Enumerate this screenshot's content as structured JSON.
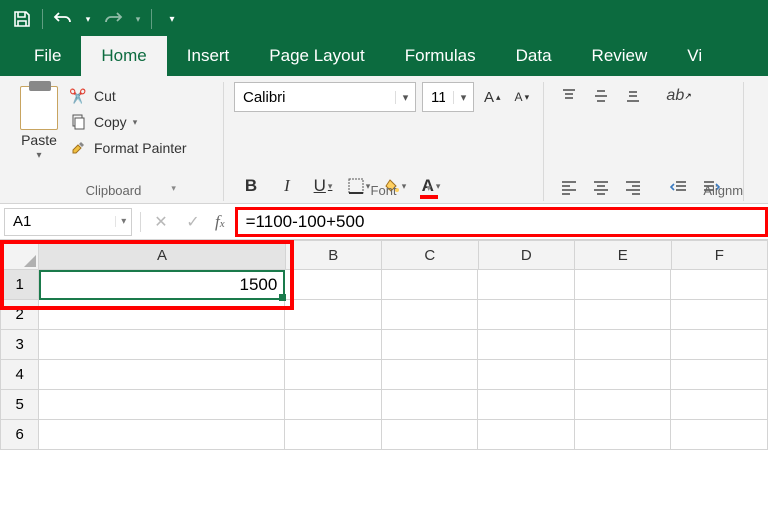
{
  "qat": {
    "save": "save",
    "undo": "undo",
    "redo": "redo"
  },
  "tabs": {
    "file": "File",
    "home": "Home",
    "insert": "Insert",
    "page_layout": "Page Layout",
    "formulas": "Formulas",
    "data": "Data",
    "review": "Review",
    "view": "Vi"
  },
  "ribbon": {
    "clipboard": {
      "paste": "Paste",
      "cut": "Cut",
      "copy": "Copy",
      "format_painter": "Format Painter",
      "group_label": "Clipboard"
    },
    "font": {
      "name": "Calibri",
      "size": "11",
      "bold": "B",
      "italic": "I",
      "underline": "U",
      "group_label": "Font",
      "font_color": "A"
    },
    "alignment": {
      "group_label": "Alignm"
    }
  },
  "formula_bar": {
    "name_box": "A1",
    "formula": "=1100-100+500"
  },
  "columns": [
    "A",
    "B",
    "C",
    "D",
    "E",
    "F"
  ],
  "rows": [
    "1",
    "2",
    "3",
    "4",
    "5",
    "6"
  ],
  "cells": {
    "A1": "1500"
  }
}
